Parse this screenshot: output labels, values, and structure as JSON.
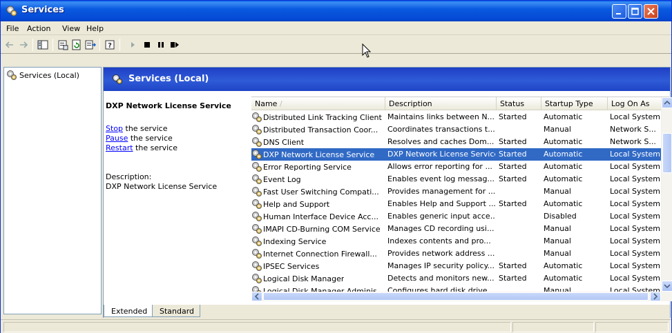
{
  "window": {
    "title": "Services"
  },
  "menu": [
    "File",
    "Action",
    "View",
    "Help"
  ],
  "tree": {
    "item": "Services (Local)"
  },
  "header": {
    "title": "Services (Local)"
  },
  "extended": {
    "service_name": "DXP Network License Service",
    "stop_link": "Stop",
    "stop_rest": " the service",
    "pause_link": "Pause",
    "pause_rest": " the service",
    "restart_link": "Restart",
    "restart_rest": " the service",
    "desc_label": "Description:",
    "desc_text": "DXP Network License Service"
  },
  "columns": [
    "Name",
    "Description",
    "Status",
    "Startup Type",
    "Log On As"
  ],
  "rows": [
    {
      "name": "Distributed Link Tracking Client",
      "desc": "Maintains links between N...",
      "status": "Started",
      "startup": "Automatic",
      "logon": "Local System"
    },
    {
      "name": "Distributed Transaction Coor...",
      "desc": "Coordinates transactions t...",
      "status": "",
      "startup": "Manual",
      "logon": "Network S..."
    },
    {
      "name": "DNS Client",
      "desc": "Resolves and caches Dom...",
      "status": "Started",
      "startup": "Automatic",
      "logon": "Network S..."
    },
    {
      "name": "DXP Network License Service",
      "desc": "DXP Network License Service",
      "status": "Started",
      "startup": "Automatic",
      "logon": "Local System",
      "selected": true
    },
    {
      "name": "Error Reporting Service",
      "desc": "Allows error reporting for ...",
      "status": "Started",
      "startup": "Automatic",
      "logon": "Local System"
    },
    {
      "name": "Event Log",
      "desc": "Enables event log messag...",
      "status": "Started",
      "startup": "Automatic",
      "logon": "Local System"
    },
    {
      "name": "Fast User Switching Compati...",
      "desc": "Provides management for ...",
      "status": "",
      "startup": "Manual",
      "logon": "Local System"
    },
    {
      "name": "Help and Support",
      "desc": "Enables Help and Support ...",
      "status": "Started",
      "startup": "Automatic",
      "logon": "Local System"
    },
    {
      "name": "Human Interface Device Acc...",
      "desc": "Enables generic input acce...",
      "status": "",
      "startup": "Disabled",
      "logon": "Local System"
    },
    {
      "name": "IMAPI CD-Burning COM Service",
      "desc": "Manages CD recording usi...",
      "status": "",
      "startup": "Manual",
      "logon": "Local System"
    },
    {
      "name": "Indexing Service",
      "desc": "Indexes contents and pro...",
      "status": "",
      "startup": "Manual",
      "logon": "Local System"
    },
    {
      "name": "Internet Connection Firewall...",
      "desc": "Provides network address ...",
      "status": "",
      "startup": "Manual",
      "logon": "Local System"
    },
    {
      "name": "IPSEC Services",
      "desc": "Manages IP security policy...",
      "status": "Started",
      "startup": "Automatic",
      "logon": "Local System"
    },
    {
      "name": "Logical Disk Manager",
      "desc": "Detects and monitors new...",
      "status": "Started",
      "startup": "Automatic",
      "logon": "Local System"
    },
    {
      "name": "Logical Disk Manager Adminis...",
      "desc": "Configures hard disk drive...",
      "status": "",
      "startup": "Manual",
      "logon": "Local System"
    }
  ],
  "tabs": {
    "extended": "Extended",
    "standard": "Standard"
  },
  "icons": {
    "gear": "services-gear-icon",
    "back": "back-arrow-icon",
    "forward": "forward-arrow-icon",
    "play": "play-icon",
    "stop": "stop-icon",
    "pause": "pause-icon",
    "restart": "restart-icon"
  },
  "colors": {
    "selection": "#316ac5",
    "title_bar": "#0a5ae0",
    "header_band": "#2f5bd7",
    "link": "#0000ff"
  }
}
